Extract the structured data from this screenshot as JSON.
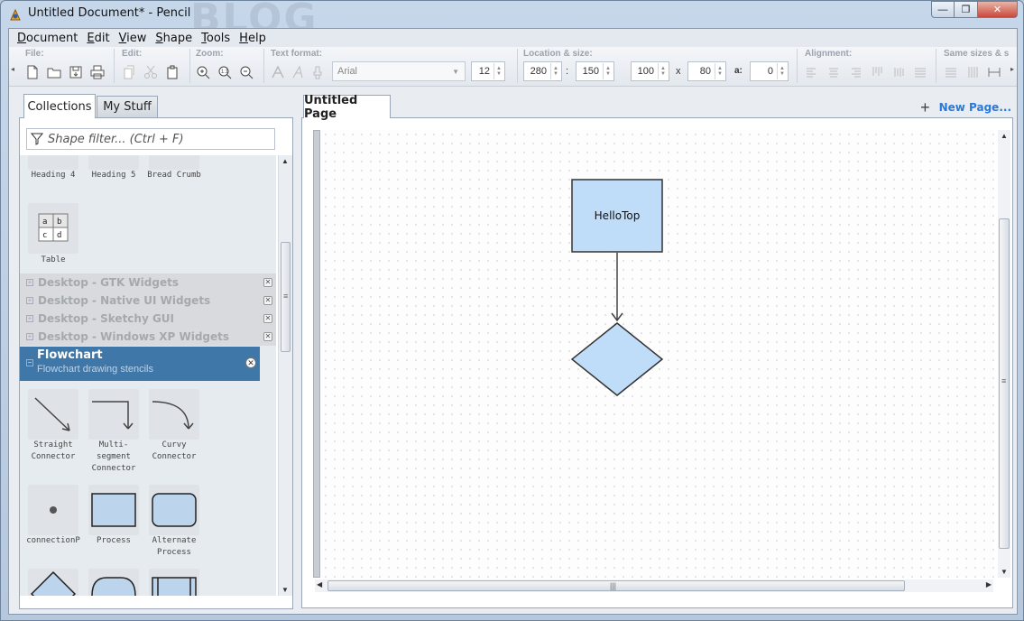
{
  "window": {
    "title": "Untitled Document* - Pencil",
    "watermark": "BLOG",
    "buttons": {
      "minimize": "—",
      "maximize": "❐",
      "close": "✕"
    }
  },
  "menu": [
    {
      "label": "Document",
      "u": "D",
      "rest": "ocument"
    },
    {
      "label": "Edit",
      "u": "E",
      "rest": "dit"
    },
    {
      "label": "View",
      "u": "V",
      "rest": "iew"
    },
    {
      "label": "Shape",
      "u": "S",
      "rest": "hape"
    },
    {
      "label": "Tools",
      "u": "T",
      "rest": "ools"
    },
    {
      "label": "Help",
      "u": "H",
      "rest": "elp"
    }
  ],
  "toolbar": {
    "file_label": "File:",
    "edit_label": "Edit:",
    "zoom_label": "Zoom:",
    "text_format_label": "Text format:",
    "location_label": "Location & size:",
    "alignment_label": "Alignment:",
    "same_sizes_label": "Same sizes & s",
    "font_family": "Arial",
    "font_size": "12",
    "x": "280",
    "y": "150",
    "width": "100",
    "height": "80",
    "angle_label": "a:",
    "angle": "0",
    "colon": ":",
    "times": "x"
  },
  "left_panel": {
    "tabs": [
      "Collections",
      "My Stuff"
    ],
    "filter_placeholder": "Shape filter... (Ctrl + F)",
    "top_shapes": [
      "Heading 4",
      "Heading 5",
      "Bread Crumb"
    ],
    "table_shape": "Table",
    "table_cells": [
      "a",
      "b",
      "c",
      "d"
    ],
    "collections": [
      "Desktop - GTK Widgets",
      "Desktop - Native UI Widgets",
      "Desktop - Sketchy GUI",
      "Desktop - Windows XP Widgets"
    ],
    "active_collection": {
      "name": "Flowchart",
      "description": "Flowchart drawing stencils"
    },
    "flowchart_shapes": [
      "Straight Connector",
      "Multi-segment Connector",
      "Curvy Connector",
      "connectionP",
      "Process",
      "Alternate Process"
    ]
  },
  "right_panel": {
    "page_tab": "Untitled Page",
    "new_page": "New Page...",
    "canvas": {
      "box_label": "HelloTop",
      "shape_fill": "#bfdcf8",
      "shape_stroke": "#333333"
    }
  }
}
